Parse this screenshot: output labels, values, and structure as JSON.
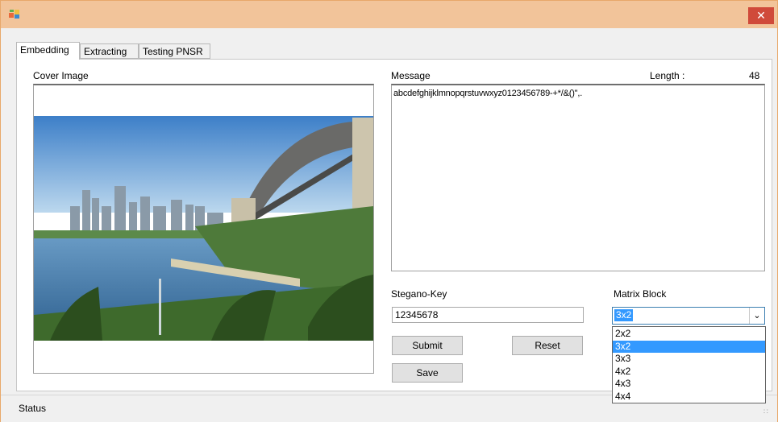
{
  "tabs": [
    {
      "label": "Embedding",
      "active": true
    },
    {
      "label": "Extracting",
      "active": false
    },
    {
      "label": "Testing PNSR",
      "active": false
    }
  ],
  "cover": {
    "label": "Cover Image"
  },
  "message": {
    "label": "Message",
    "length_label": "Length :",
    "length_value": "48",
    "text": "abcdefghijklmnopqrstuvwxyz0123456789-+*/&()\",."
  },
  "key": {
    "label": "Stegano-Key",
    "value": "12345678"
  },
  "matrix": {
    "label": "Matrix Block",
    "selected": "3x2",
    "options": [
      "2x2",
      "3x2",
      "3x3",
      "4x2",
      "4x3",
      "4x4"
    ],
    "highlighted_index": 1
  },
  "buttons": {
    "submit": "Submit",
    "reset": "Reset",
    "save": "Save"
  },
  "close_glyph": "✕",
  "status": {
    "text": "Status"
  }
}
